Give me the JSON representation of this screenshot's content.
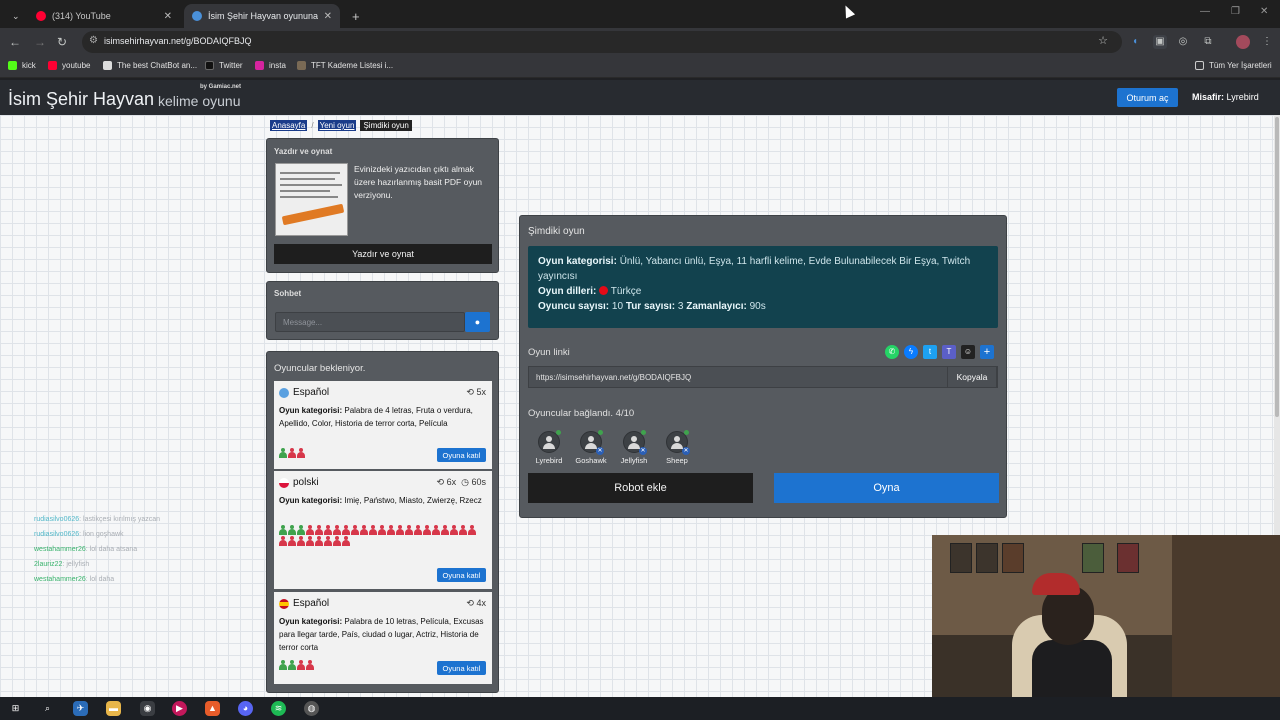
{
  "browser": {
    "tabs": [
      {
        "title": "(314) YouTube",
        "favicon": "youtube-icon",
        "color": "#ff0033"
      },
      {
        "title": "İsim Şehir Hayvan oyununa katı",
        "favicon": "site-icon",
        "color": "#4a90d9"
      }
    ],
    "url": "isimsehirhayvan.net/g/BODAIQFBJQ",
    "bookmarks": [
      {
        "label": "kick",
        "icon": "kick-icon",
        "color": "#53fc18"
      },
      {
        "label": "youtube",
        "icon": "youtube-icon",
        "color": "#ff0033"
      },
      {
        "label": "The best ChatBot an...",
        "icon": "chatbot-icon",
        "color": "#dddddd"
      },
      {
        "label": "Twitter",
        "icon": "x-icon",
        "color": "#111111"
      },
      {
        "label": "insta",
        "icon": "instagram-icon",
        "color": "#d6249f"
      },
      {
        "label": "TFT Kademe Listesi i...",
        "icon": "tft-icon",
        "color": "#7a6a55"
      }
    ],
    "all_bookmarks": "Tüm Yer İşaretleri"
  },
  "site": {
    "logo_main": "İsim Şehir Hayvan",
    "logo_sub": "kelime oyunu",
    "logo_by": "by Gamiac.net",
    "login": "Oturum aç",
    "guest_label": "Misafir:",
    "guest_name": "Lyrebird"
  },
  "breadcrumb": [
    "Anasayfa",
    "Yeni oyun",
    "Şimdiki oyun"
  ],
  "print_panel": {
    "title": "Yazdır ve oynat",
    "text": "Evinizdeki yazıcıdan çıktı almak üzere hazırlanmış basit PDF oyun verziyonu.",
    "button": "Yazdır ve oynat"
  },
  "chat_panel": {
    "title": "Sohbet",
    "placeholder": "Message..."
  },
  "waiting": {
    "title": "Oyuncular bekleniyor.",
    "join_label": "Oyuna katıl",
    "category_label": "Oyun kategorisi:",
    "rooms": [
      {
        "lang": "Español",
        "flag_color": "#5aa0e0",
        "rounds": "5x",
        "timer": "",
        "categories": "Palabra de 4 letras, Fruta o verdura, Apellido, Color, Historia de terror corta, Película",
        "players_joined": 1,
        "players_total": 3
      },
      {
        "lang": "polski",
        "flag_color": "#dc143c",
        "rounds": "6x",
        "timer": "60s",
        "categories": "Imię, Państwo, Miasto, Zwierzę, Rzecz",
        "players_joined": 3,
        "players_total": 30
      },
      {
        "lang": "Español",
        "flag_color": "#e8c23a",
        "rounds": "4x",
        "timer": "",
        "categories": "Palabra de 10 letras, Película, Excusas para llegar tarde, País, ciudad o lugar, Actriz, Historia de terror corta",
        "players_joined": 2,
        "players_total": 4
      }
    ]
  },
  "current_game": {
    "title": "Şimdiki oyun",
    "category_label": "Oyun kategorisi:",
    "categories": "Ünlü, Yabancı ünlü, Eşya, 11 harfli kelime, Evde Bulunabilecek Bir Eşya, Twitch yayıncısı",
    "lang_label": "Oyun dilleri:",
    "lang_value": "Türkçe",
    "players_label": "Oyuncu sayısı:",
    "players_value": "10",
    "rounds_label": "Tur sayısı:",
    "rounds_value": "3",
    "timer_label": "Zamanlayıcı:",
    "timer_value": "90s",
    "link_label": "Oyun linki",
    "link": "https://isimsehirhayvan.net/g/BODAIQFBJQ",
    "copy": "Kopyala",
    "connected_label": "Oyuncular bağlandı.",
    "connected_count": "4/10",
    "players": [
      "Lyrebird",
      "Goshawk",
      "Jellyfish",
      "Sheep"
    ],
    "robot_kick": "Robot ekle",
    "play": "Oyna",
    "share_icons": [
      {
        "icon": "whatsapp-icon",
        "color": "#25d366"
      },
      {
        "icon": "messenger-icon",
        "color": "#0a7cff"
      },
      {
        "icon": "twitter-icon",
        "color": "#1da1f2"
      },
      {
        "icon": "teams-icon",
        "color": "#5b5fc7"
      },
      {
        "icon": "snapchat-icon",
        "color": "#222222"
      },
      {
        "icon": "add-share-icon",
        "color": "#1d73d0"
      }
    ]
  },
  "stream_chat": [
    {
      "user": "rudiasilvo0626",
      "msg": "lastikçesi kırılmış yazcan"
    },
    {
      "user": "rudiasilvo0626",
      "msg": "lion goşhawk"
    },
    {
      "user": "westahammer26",
      "msg": "lol daha atsana"
    },
    {
      "user": "2lauriz22",
      "msg": "jellyfish"
    },
    {
      "user": "westahammer26",
      "msg": "lol daha"
    }
  ]
}
